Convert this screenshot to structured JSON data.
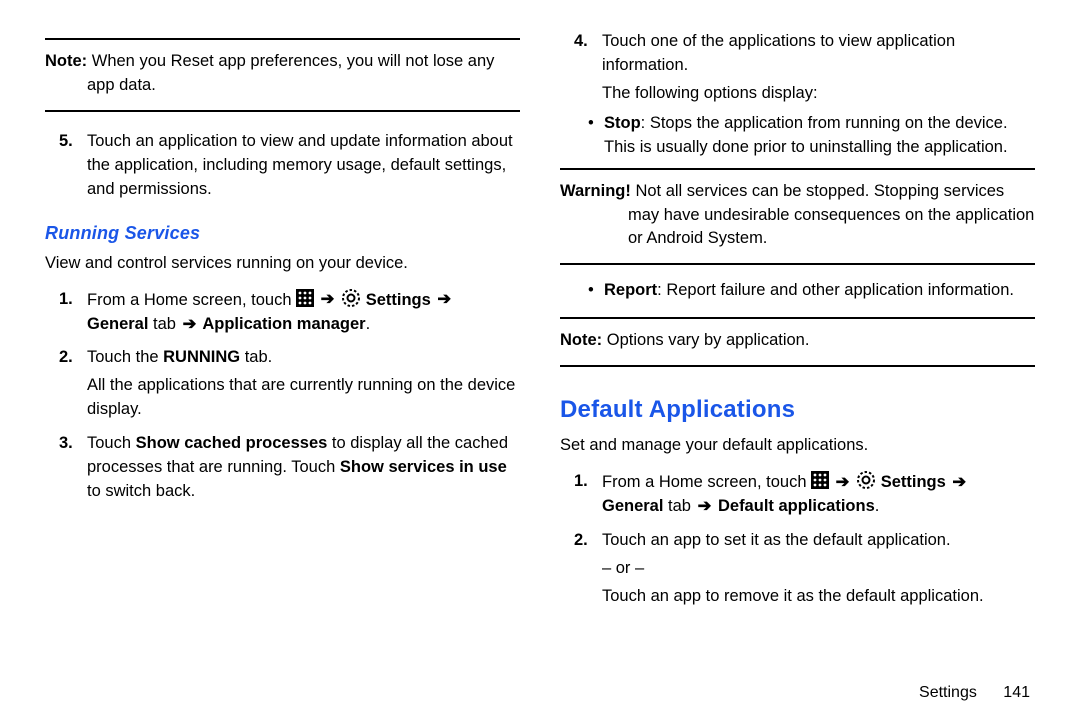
{
  "left": {
    "note1_lead": "Note:",
    "note1_text": " When you Reset app preferences, you will not lose any",
    "note1_text2": "app data.",
    "step5_num": "5.",
    "step5_text": "Touch an application to view and update information about the application, including memory usage, default settings, and permissions.",
    "h3": "Running Services",
    "intro": "View and control services running on your device.",
    "s1_num": "1.",
    "s1_a": "From a Home screen, touch ",
    "s1_settings": " Settings ",
    "s1_general": "General",
    "s1_tab": " tab ",
    "s1_appmgr": " Application manager",
    "s2_num": "2.",
    "s2_a": "Touch the ",
    "s2_running": "RUNNING",
    "s2_b": " tab.",
    "s2_c": "All the applications that are currently running on the device display.",
    "s3_num": "3.",
    "s3_a": "Touch ",
    "s3_scp": "Show cached processes",
    "s3_b": " to display all the cached processes that are running. Touch ",
    "s3_siu": "Show services in use",
    "s3_c": " to switch back."
  },
  "right": {
    "s4_num": "4.",
    "s4_a": "Touch one of the applications to view application information.",
    "s4_b": "The following options display:",
    "bul_stop_lead": "Stop",
    "bul_stop_text": ": Stops the application from running on the device. This is usually done prior to uninstalling the application.",
    "warn_lead": "Warning!",
    "warn_text": " Not all services can be stopped. Stopping services",
    "warn_text2": "may have undesirable consequences on the application or Android System.",
    "bul_report_lead": "Report",
    "bul_report_text": ": Report failure and other application information.",
    "note2_lead": "Note:",
    "note2_text": " Options vary by application.",
    "h2": "Default Applications",
    "intro2": "Set and manage your default applications.",
    "d1_num": "1.",
    "d1_a": "From a Home screen, touch ",
    "d1_settings": " Settings ",
    "d1_general": "General",
    "d1_tab": " tab ",
    "d1_defapps": " Default applications",
    "d2_num": "2.",
    "d2_a": "Touch an app to set it as the default application.",
    "d2_or": "– or –",
    "d2_b": "Touch an app to remove it as the default application."
  },
  "footer": {
    "chapter": "Settings",
    "page": "141"
  },
  "glyphs": {
    "arrow": "➔",
    "bullet": "•",
    "period": "."
  }
}
